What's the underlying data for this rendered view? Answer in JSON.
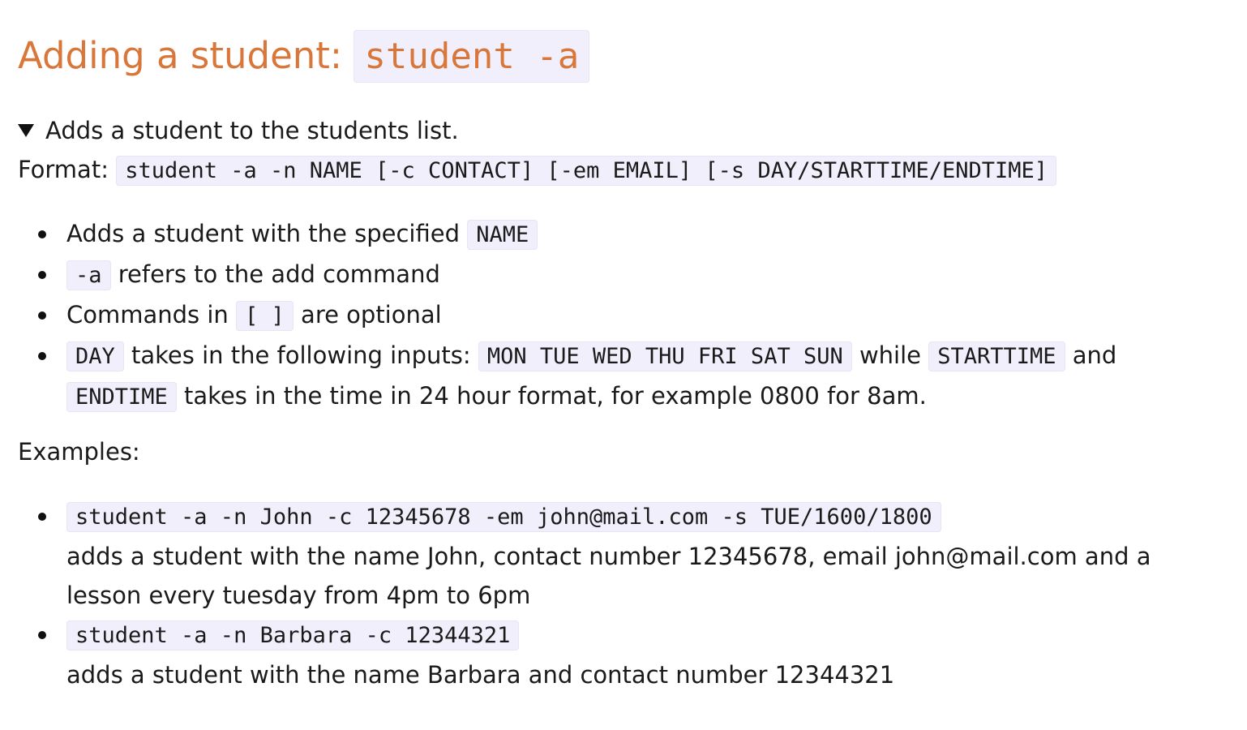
{
  "heading": {
    "text": "Adding a student: ",
    "code": "student -a"
  },
  "summary": "Adds a student to the students list.",
  "format": {
    "label": "Format: ",
    "code": "student -a -n NAME [-c CONTACT] [-em EMAIL] [-s DAY/STARTTIME/ENDTIME]"
  },
  "notes": [
    {
      "pre": "Adds a student with the specified ",
      "code1": "NAME"
    },
    {
      "code1": "-a",
      "post": " refers to the add command"
    },
    {
      "pre": "Commands in ",
      "code1": "[ ]",
      "post": " are optional"
    },
    {
      "code1": "DAY",
      "mid1": " takes in the following inputs: ",
      "code2": "MON TUE WED THU FRI SAT SUN",
      "mid2": " while ",
      "code3": "STARTTIME",
      "mid3": " and ",
      "code4": "ENDTIME",
      "post": " takes in the time in 24 hour format, for example 0800 for 8am."
    }
  ],
  "examples_label": "Examples:",
  "examples": [
    {
      "code": "student -a -n John -c 12345678 -em john@mail.com -s TUE/1600/1800",
      "desc": "adds a student with the name John, contact number 12345678, email john@mail.com and a lesson every tuesday from 4pm to 6pm"
    },
    {
      "code": "student -a -n Barbara -c 12344321",
      "desc": "adds a student with the name Barbara and contact number 12344321"
    }
  ],
  "colors": {
    "heading": "#d9773a",
    "code_background": "#f0effb",
    "text": "#1a1a1a"
  }
}
